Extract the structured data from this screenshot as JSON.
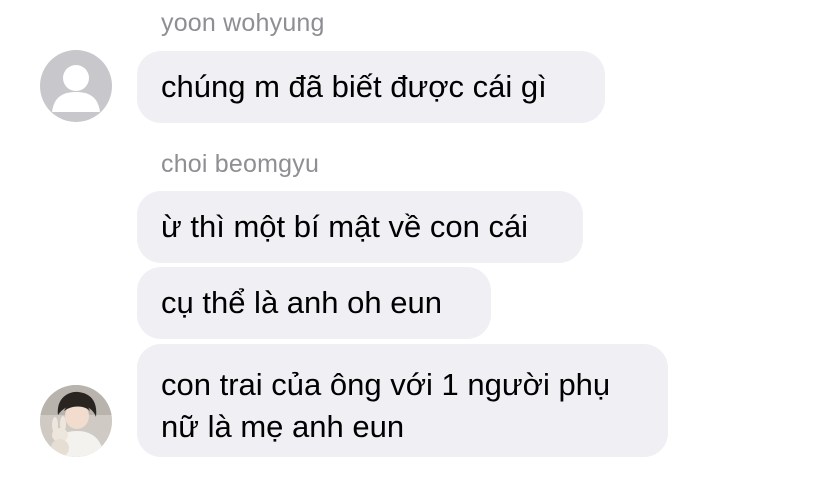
{
  "messages": {
    "group1": {
      "sender": "yoon wohyung",
      "avatar_icon": "default-person-icon",
      "texts": [
        "chúng m đã biết được cái gì"
      ]
    },
    "group2": {
      "sender": "choi beomgyu",
      "avatar_icon": "profile-photo",
      "texts": [
        "ừ thì một bí mật về con cái",
        "cụ thể là anh oh eun",
        "con trai của ông với 1 người phụ nữ là mẹ anh eun"
      ]
    }
  },
  "colors": {
    "bubble": "#efeff4",
    "sender_name": "#8e8e93",
    "default_avatar_bg": "#c7c7cc"
  }
}
